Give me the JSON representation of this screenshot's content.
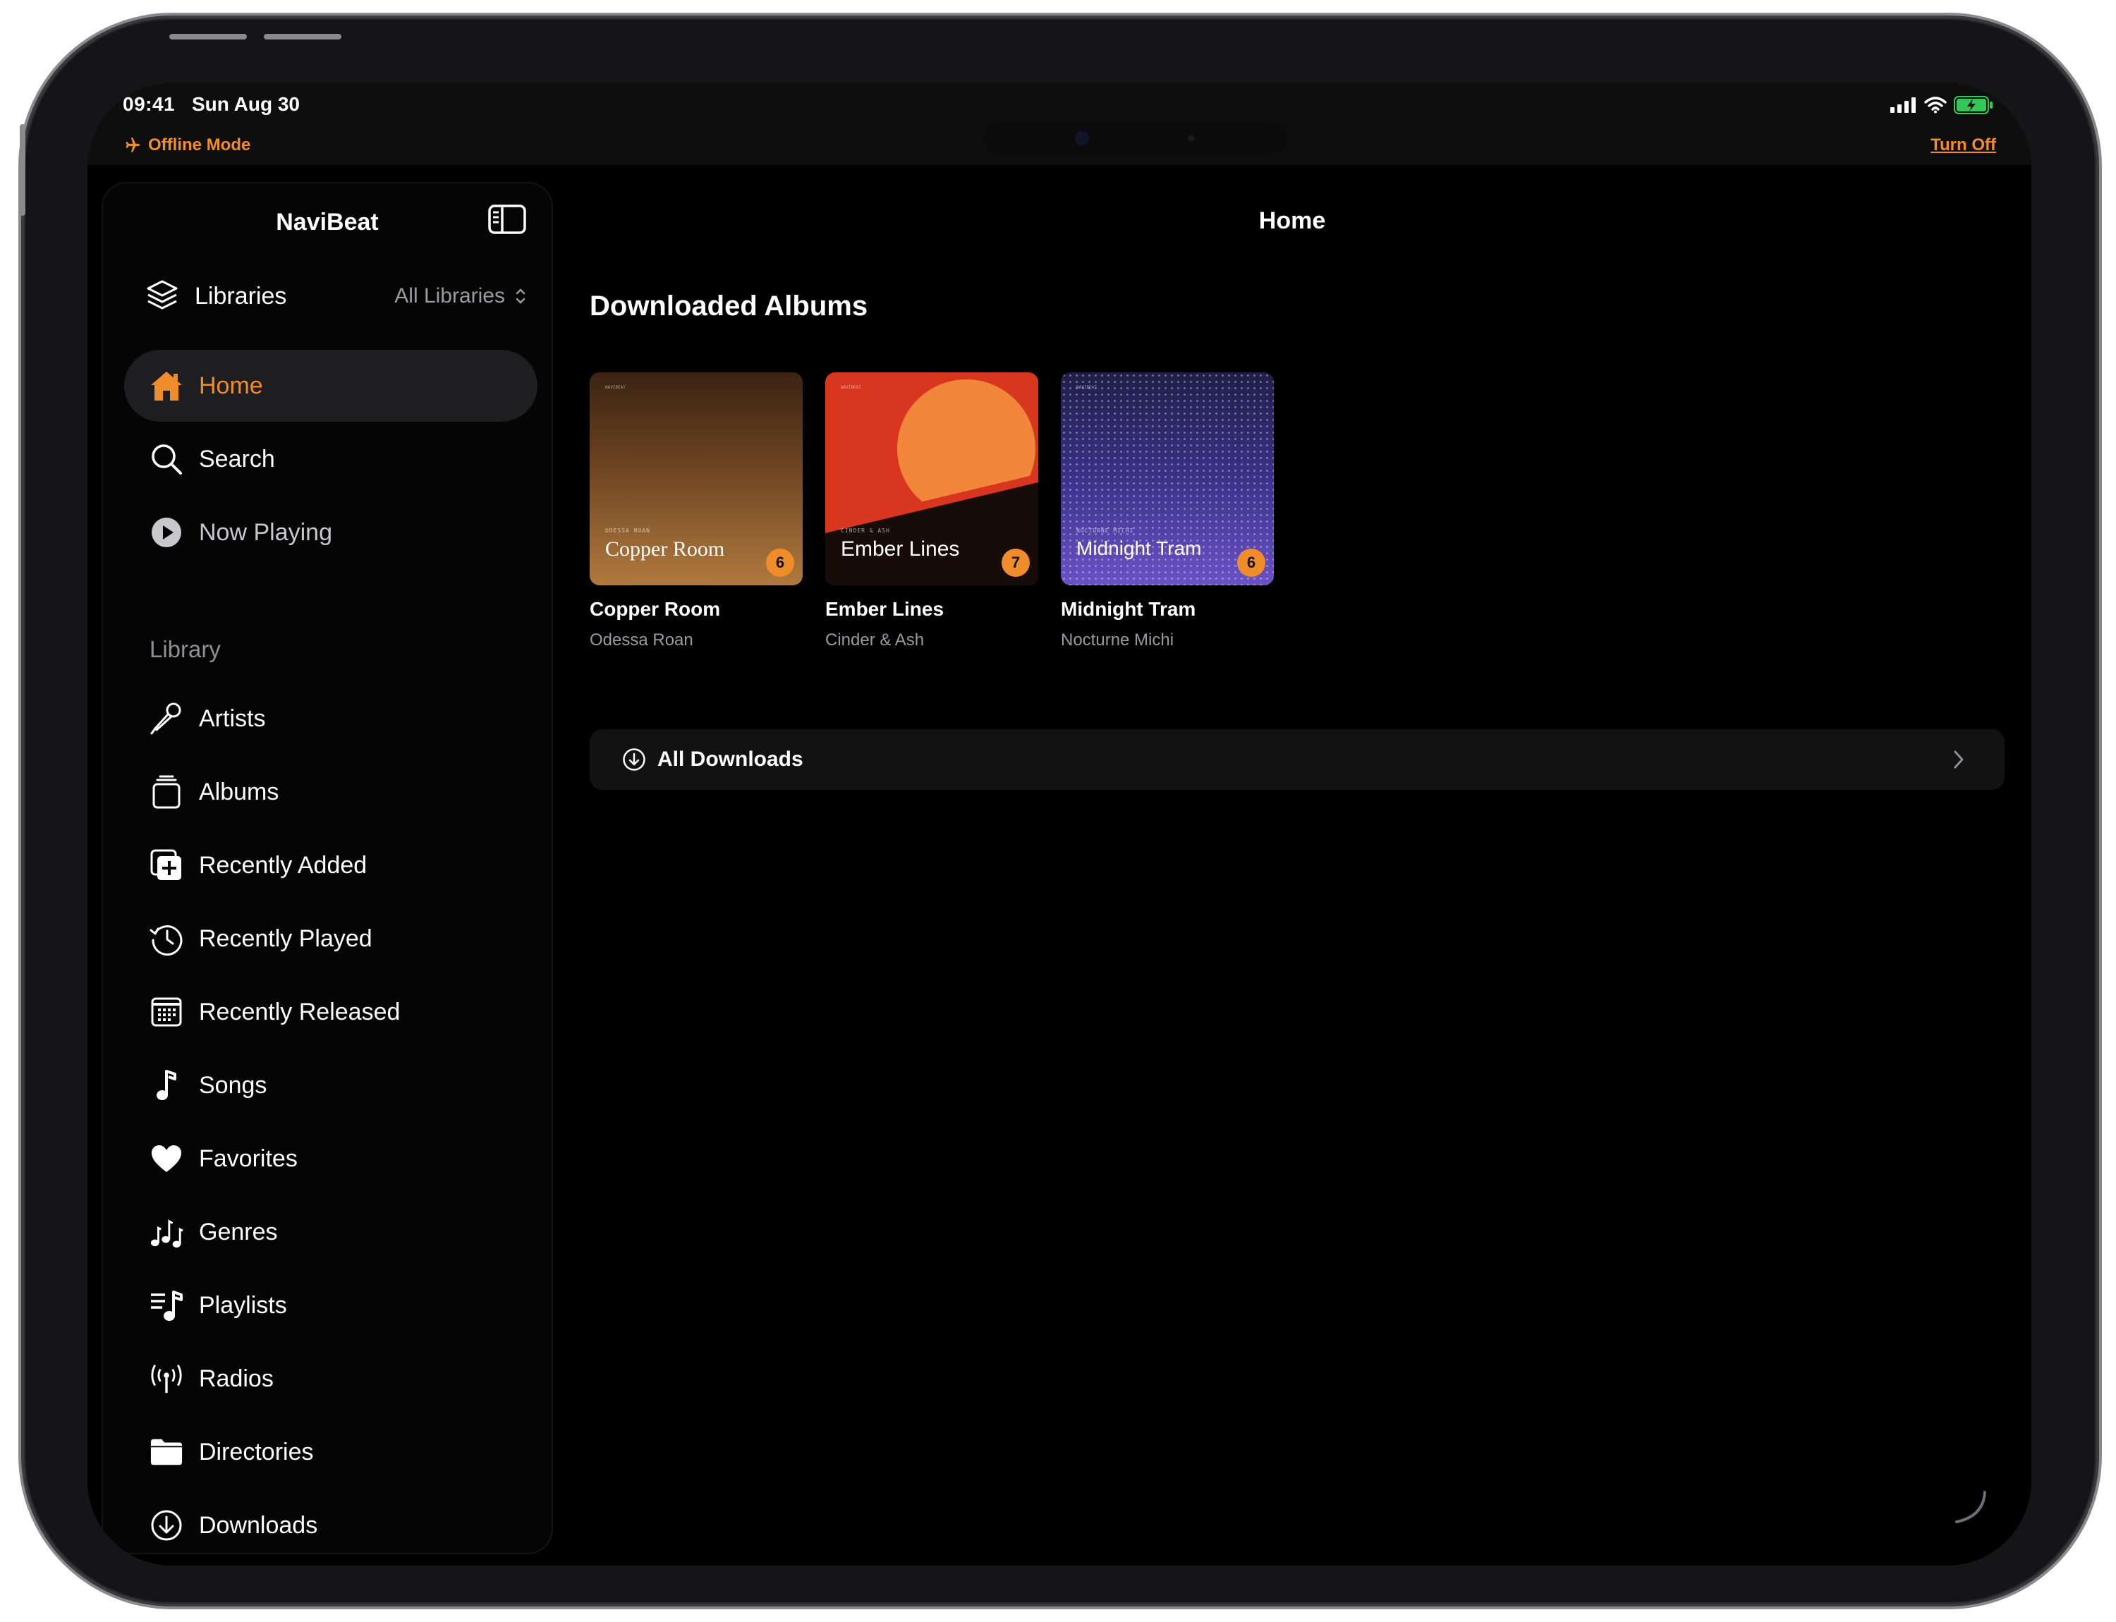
{
  "status_bar": {
    "time": "09:41",
    "date": "Sun Aug 30",
    "offline_label": "Offline Mode",
    "turn_off_label": "Turn Off",
    "accent": "#f08d2b"
  },
  "sidebar": {
    "app_title": "NaviBeat",
    "libraries": {
      "label": "Libraries",
      "value": "All Libraries"
    },
    "nav": [
      {
        "label": "Home",
        "icon": "house-icon",
        "active": true
      },
      {
        "label": "Search",
        "icon": "magnifier-icon"
      },
      {
        "label": "Now Playing",
        "icon": "play-circle-icon"
      }
    ],
    "section_label": "Library",
    "library_items": [
      {
        "label": "Artists",
        "icon": "microphone-icon"
      },
      {
        "label": "Albums",
        "icon": "albums-stack-icon"
      },
      {
        "label": "Recently Added",
        "icon": "plus-square-stack-icon"
      },
      {
        "label": "Recently Played",
        "icon": "history-clock-icon"
      },
      {
        "label": "Recently Released",
        "icon": "calendar-icon"
      },
      {
        "label": "Songs",
        "icon": "music-note-icon"
      },
      {
        "label": "Favorites",
        "icon": "heart-icon"
      },
      {
        "label": "Genres",
        "icon": "music-notes-icon"
      },
      {
        "label": "Playlists",
        "icon": "music-list-icon"
      },
      {
        "label": "Radios",
        "icon": "antenna-radio-icon"
      },
      {
        "label": "Directories",
        "icon": "folder-icon"
      },
      {
        "label": "Downloads",
        "icon": "download-circle-icon"
      }
    ]
  },
  "main": {
    "title": "Home",
    "section_title": "Downloaded Albums",
    "albums": [
      {
        "title": "Copper Room",
        "artist": "Odessa Roan",
        "cover_title": "Copper Room",
        "cover_artist": "ODESSA ROAN",
        "count": "6"
      },
      {
        "title": "Ember Lines",
        "artist": "Cinder & Ash",
        "cover_title": "Ember Lines",
        "cover_artist": "CINDER & ASH",
        "count": "7"
      },
      {
        "title": "Midnight Tram",
        "artist": "Nocturne Michi",
        "cover_title": "Midnight Tram",
        "cover_artist": "NOCTURNE MICHI",
        "count": "6"
      }
    ],
    "cover_mark": "NAVIBEAT",
    "all_downloads_label": "All Downloads"
  }
}
